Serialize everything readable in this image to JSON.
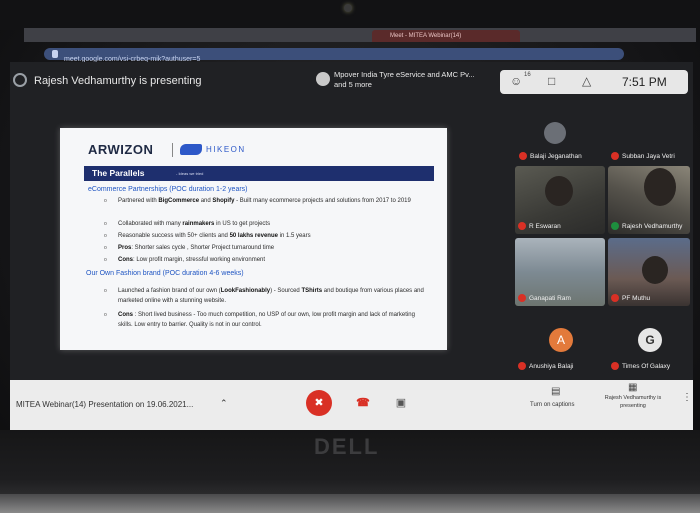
{
  "browser": {
    "tab_title": "Meet - MITEA Webinar(14)",
    "url": "meet.google.com/vsi-crbeq-mik?authuser=5"
  },
  "meeting": {
    "presenting_banner": "Rajesh Vedhamurthy is presenting",
    "notification": "Mpover India Tyre eService and AMC Pv... and 5 more",
    "participant_count": "16",
    "clock": "7:51 PM",
    "title": "MITEA Webinar(14) Presentation on 19.06.2021..."
  },
  "slide": {
    "brand_left": "ARWIZON",
    "brand_right": "HIKEON",
    "section_title": "The Parallels",
    "section_subtitle": "- Ideas we tried",
    "heading_1": "eCommerce Partnerships (POC duration 1-2 years)",
    "bullets_1": [
      {
        "pre": "Partnered with ",
        "b1": "BigCommerce",
        "mid": " and ",
        "b2": "Shopify",
        "post": " - Built many ecommerce projects and solutions from 2017 to 2019"
      },
      {
        "pre": "Collaborated with many ",
        "b1": "rainmakers",
        "mid": "",
        "b2": "",
        "post": " in US to get projects"
      },
      {
        "pre": "Reasonable success with 50+ clients and ",
        "b1": "50 lakhs revenue",
        "mid": "",
        "b2": "",
        "post": " in 1.5 years"
      },
      {
        "pre": "",
        "b1": "Pros",
        "mid": "",
        "b2": "",
        "post": ": Shorter sales cycle , Shorter Project turnaround time"
      },
      {
        "pre": "",
        "b1": "Cons",
        "mid": "",
        "b2": "",
        "post": ": Low profit margin, stressful working environment"
      }
    ],
    "heading_2": "Our Own Fashion brand (POC duration 4-6 weeks)",
    "bullets_2": [
      {
        "pre": "Launched a fashion brand of our own (",
        "b1": "LookFashionably",
        "mid": ") - Sourced ",
        "b2": "TShirts",
        "post": " and boutique from various places and marketed online with a stunning website."
      },
      {
        "pre": "",
        "b1": "Cons",
        "mid": "",
        "b2": "",
        "post": " : Short lived business - Too much competition, no USP of our own, low profit margin and lack of marketing skills. Low entry to barrier. Quality is not in our control."
      }
    ]
  },
  "participants": [
    {
      "name": "Balaji Jeganathan",
      "muted": true
    },
    {
      "name": "Subban Jaya Vetri",
      "muted": true
    },
    {
      "name": "R Eswaran",
      "muted": true
    },
    {
      "name": "Rajesh Vedhamurthy",
      "muted": false
    },
    {
      "name": "Ganapati Ram",
      "muted": true
    },
    {
      "name": "PF Muthu",
      "muted": true
    },
    {
      "name": "Anushiya Balaji",
      "muted": true,
      "avatar_letter": "A"
    },
    {
      "name": "Times Of Galaxy",
      "muted": true,
      "avatar_letter": "G"
    }
  ],
  "controls": {
    "captions_label": "Turn on captions",
    "presenting_label": "Rajesh Vedhamurthy is presenting"
  },
  "laptop": {
    "brand": "DELL"
  },
  "colors": {
    "meet_dark": "#202124",
    "mute_red": "#d93025",
    "slide_band": "#1e2f6e",
    "slide_heading": "#1f55c2"
  }
}
